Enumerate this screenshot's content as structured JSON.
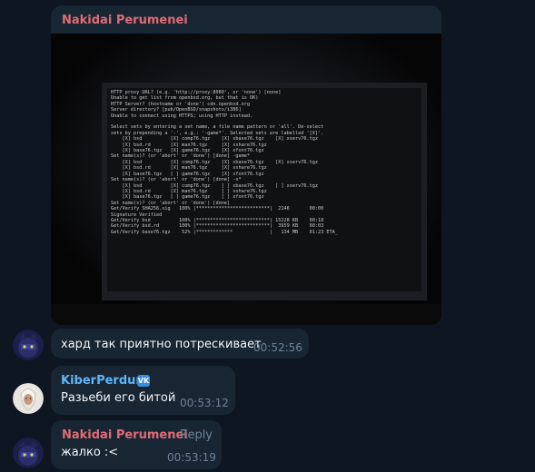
{
  "messages": [
    {
      "sender": "Nakidai Perumenei",
      "photo_terminal_text": "HTTP proxy URL? (e.g. 'http://proxy:8080', or 'none') [none]\nUnable to get list from openbsd.org, but that is OK)\nHTTP Server? (hostname or 'done') cdn.openbsd.org\nServer directory? [pub/OpenBSD/snapshots/i386]\nUnable to connect using HTTPS; using HTTP instead.\n\nSelect sets by entering a set name, a file name pattern or 'all'. De-select\nsets by prepending a '-', e.g.: '-game*'. Selected sets are labelled '[X]'.\n    [X] bsd          [X] comp76.tgz    [X] xbase76.tgz    [X] xserv76.tgz\n    [X] bsd.rd       [X] man76.tgz     [X] xshare76.tgz\n    [X] base76.tgz   [X] game76.tgz    [X] xfont76.tgz\nSet name(s)? (or 'abort' or 'done') [done] -game*\n    [X] bsd          [X] comp76.tgz    [X] xbase76.tgz    [X] xserv76.tgz\n    [X] bsd.rd       [X] man76.tgz     [X] xshare76.tgz\n    [X] base76.tgz   [ ] game76.tgz    [X] xfont76.tgz\nSet name(s)? (or 'abort' or 'done') [done] -x*\n    [X] bsd          [X] comp76.tgz    [ ] xbase76.tgz    [ ] xserv76.tgz\n    [X] bsd.rd       [X] man76.tgz     [ ] xshare76.tgz\n    [X] base76.tgz   [ ] game76.tgz    [ ] xfont76.tgz\nSet name(s)? (or 'abort' or 'done') [done]\nGet/Verify SHA256.sig   100% |**************************|  2146       00:00\nSignature Verified\nGet/Verify bsd          100% |**************************| 15228 KB    00:18\nGet/Verify bsd.rd       100% |**************************|  3959 KB    00:03\nGet/Verify base76.tgz    52% |*************             |   134 MB    01:23 ETA_"
    },
    {
      "text": "хард так приятно потрескивает",
      "time": "00:52:56"
    },
    {
      "sender": "KiberPerdun",
      "badge": "VK",
      "text": "Разьеби его битой",
      "time": "00:53:12"
    },
    {
      "sender": "Nakidai Perumenei",
      "reply": "Reply",
      "text": "жалко :<",
      "time": "00:53:19"
    }
  ],
  "colors": {
    "background": "#0e1621",
    "bubble": "#182533",
    "sender_red": "#e06c75",
    "sender_blue": "#5eb5f7",
    "time": "#6d8297"
  },
  "icons": [
    "avatar-dark-character",
    "avatar-white-haired",
    "vk-verified-icon"
  ]
}
